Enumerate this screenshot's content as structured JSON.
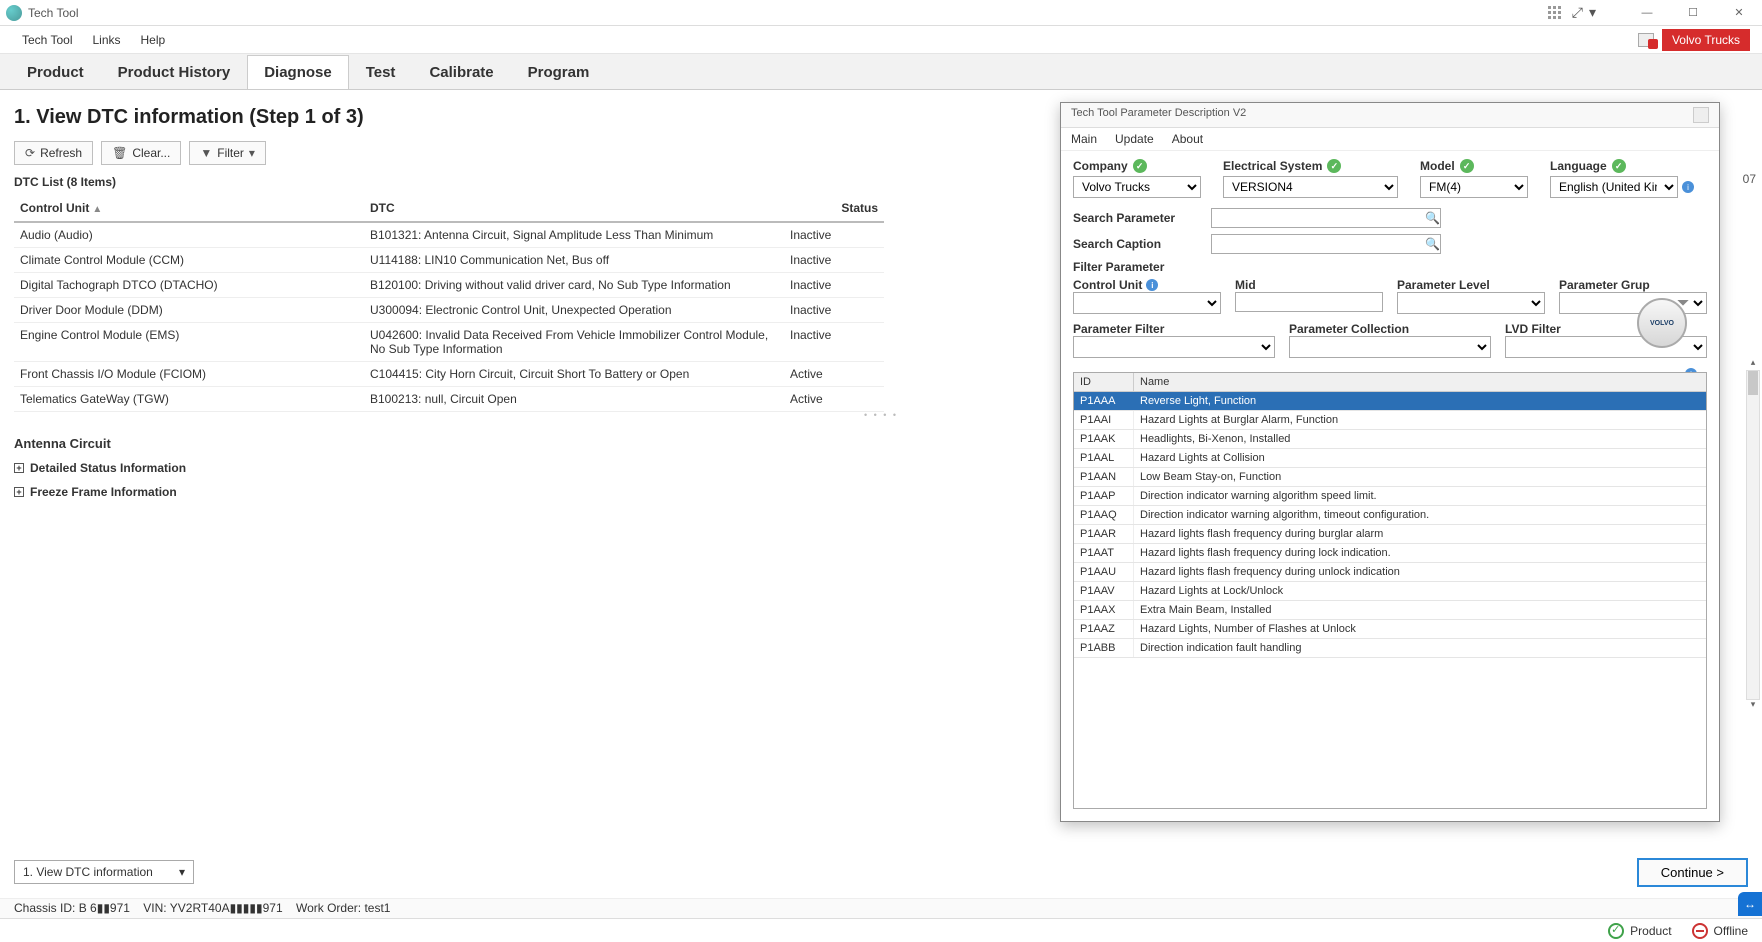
{
  "window": {
    "title": "Tech Tool"
  },
  "menubar": {
    "items": [
      "Tech Tool",
      "Links",
      "Help"
    ],
    "brand": "Volvo Trucks"
  },
  "maintabs": [
    "Product",
    "Product History",
    "Diagnose",
    "Test",
    "Calibrate",
    "Program"
  ],
  "maintabs_active": "Diagnose",
  "page": {
    "title": "1. View DTC information (Step 1 of 3)",
    "toolbar": {
      "refresh": "Refresh",
      "clear": "Clear...",
      "filter": "Filter"
    },
    "list_label": "DTC List (8 Items)",
    "columns": {
      "cu": "Control Unit",
      "dtc": "DTC",
      "status": "Status"
    },
    "rows": [
      {
        "cu": "Audio (Audio)",
        "dtc": "B101321: Antenna Circuit, Signal Amplitude Less Than Minimum",
        "status": "Inactive"
      },
      {
        "cu": "Climate Control Module (CCM)",
        "dtc": "U114188: LIN10 Communication Net, Bus off",
        "status": "Inactive"
      },
      {
        "cu": "Digital Tachograph DTCO (DTACHO)",
        "dtc": "B120100: Driving without valid driver card, No Sub Type Information",
        "status": "Inactive"
      },
      {
        "cu": "Driver Door Module (DDM)",
        "dtc": "U300094: Electronic Control Unit, Unexpected Operation",
        "status": "Inactive"
      },
      {
        "cu": "Engine Control Module (EMS)",
        "dtc": "U042600: Invalid Data Received From Vehicle Immobilizer Control Module, No Sub Type Information",
        "status": "Inactive"
      },
      {
        "cu": "Front Chassis I/O Module (FCIOM)",
        "dtc": "C104415: City Horn Circuit, Circuit Short To Battery or Open",
        "status": "Active"
      },
      {
        "cu": "Telematics GateWay (TGW)",
        "dtc": "B100213: null, Circuit Open",
        "status": "Active"
      }
    ],
    "detail_title": "Antenna Circuit",
    "expanders": {
      "status": "Detailed Status Information",
      "freeze": "Freeze Frame Information"
    },
    "step_select": "1. View DTC information",
    "continue": "Continue >"
  },
  "dialog": {
    "title": "Tech Tool Parameter Description V2",
    "menu": [
      "Main",
      "Update",
      "About"
    ],
    "selectors": {
      "company": {
        "label": "Company",
        "value": "Volvo Trucks"
      },
      "esys": {
        "label": "Electrical System",
        "value": "VERSION4"
      },
      "model": {
        "label": "Model",
        "value": "FM(4)"
      },
      "lang": {
        "label": "Language",
        "value": "English (United Kin"
      }
    },
    "search_param_label": "Search Parameter",
    "search_caption_label": "Search Caption",
    "filter_label": "Filter Parameter",
    "filters": {
      "cu": "Control Unit",
      "mid": "Mid",
      "plevel": "Parameter Level",
      "pgroup": "Parameter Grup",
      "pfilter": "Parameter Filter",
      "pcoll": "Parameter Collection",
      "lvd": "LVD Filter"
    },
    "grid_headers": {
      "id": "ID",
      "name": "Name"
    },
    "grid_rows": [
      {
        "id": "P1AAA",
        "name": "Reverse Light, Function"
      },
      {
        "id": "P1AAI",
        "name": "Hazard Lights at Burglar Alarm, Function"
      },
      {
        "id": "P1AAK",
        "name": "Headlights, Bi-Xenon, Installed"
      },
      {
        "id": "P1AAL",
        "name": "Hazard Lights at Collision"
      },
      {
        "id": "P1AAN",
        "name": "Low Beam Stay-on, Function"
      },
      {
        "id": "P1AAP",
        "name": "Direction indicator warning algorithm speed limit."
      },
      {
        "id": "P1AAQ",
        "name": "Direction indicator warning algorithm, timeout configuration."
      },
      {
        "id": "P1AAR",
        "name": "Hazard lights flash frequency during burglar alarm"
      },
      {
        "id": "P1AAT",
        "name": "Hazard lights flash frequency during lock indication."
      },
      {
        "id": "P1AAU",
        "name": "Hazard lights flash frequency during unlock indication"
      },
      {
        "id": "P1AAV",
        "name": "Hazard Lights at Lock/Unlock"
      },
      {
        "id": "P1AAX",
        "name": "Extra Main Beam, Installed"
      },
      {
        "id": "P1AAZ",
        "name": "Hazard Lights, Number of Flashes at Unlock"
      },
      {
        "id": "P1ABB",
        "name": "Direction indication fault handling"
      }
    ]
  },
  "chassis": {
    "chassis_id_label": "Chassis ID:",
    "chassis_id": "B 6▮▮971",
    "vin_label": "VIN:",
    "vin": "YV2RT40A▮▮▮▮▮971",
    "wo_label": "Work Order:",
    "wo": "test1"
  },
  "statusbar": {
    "product": "Product",
    "offline": "Offline"
  },
  "timestamp_right": "07"
}
